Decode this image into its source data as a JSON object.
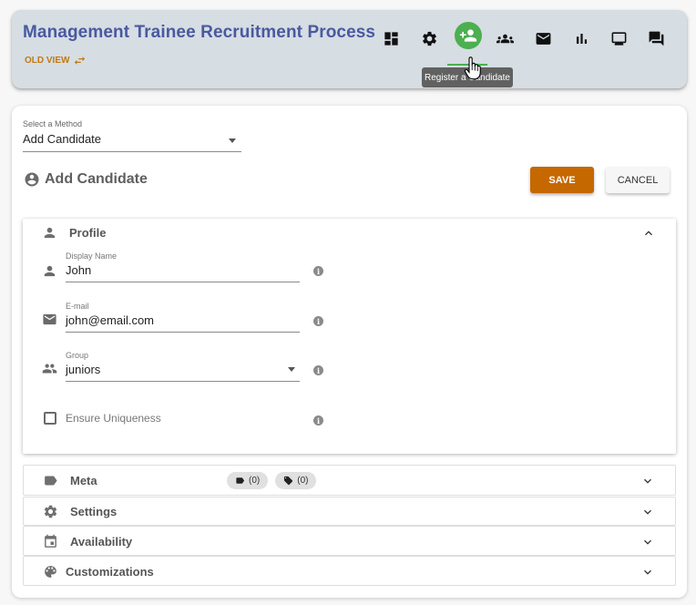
{
  "header": {
    "title": "Management Trainee Recruitment Process",
    "old_view_label": "OLD VIEW",
    "tooltip": "Register a Candidate",
    "toolbar": [
      {
        "id": "dashboard",
        "icon": "dashboard-icon"
      },
      {
        "id": "settings",
        "icon": "gear-icon"
      },
      {
        "id": "register",
        "icon": "person-add-icon",
        "active": true
      },
      {
        "id": "candidates",
        "icon": "groups-icon"
      },
      {
        "id": "messages",
        "icon": "mail-icon"
      },
      {
        "id": "stats",
        "icon": "bar-chart-icon"
      },
      {
        "id": "monitor",
        "icon": "monitor-icon"
      },
      {
        "id": "chat",
        "icon": "forum-icon"
      }
    ],
    "accent_color": "#4caf50",
    "title_color": "#4959a0"
  },
  "method": {
    "label": "Select a Method",
    "value": "Add Candidate"
  },
  "form": {
    "title": "Add Candidate",
    "save_label": "SAVE",
    "cancel_label": "CANCEL",
    "save_color": "#c56800"
  },
  "profile": {
    "title": "Profile",
    "display_name": {
      "label": "Display Name",
      "value": "John"
    },
    "email": {
      "label": "E-mail",
      "value": "john@email.com"
    },
    "group": {
      "label": "Group",
      "value": "juniors"
    },
    "uniqueness_label": "Ensure Uniqueness",
    "uniqueness_checked": false
  },
  "sections": {
    "meta": {
      "title": "Meta",
      "labels_count": "(0)",
      "tags_count": "(0)"
    },
    "settings": {
      "title": "Settings"
    },
    "availability": {
      "title": "Availability"
    },
    "customizations": {
      "title": "Customizations"
    }
  }
}
